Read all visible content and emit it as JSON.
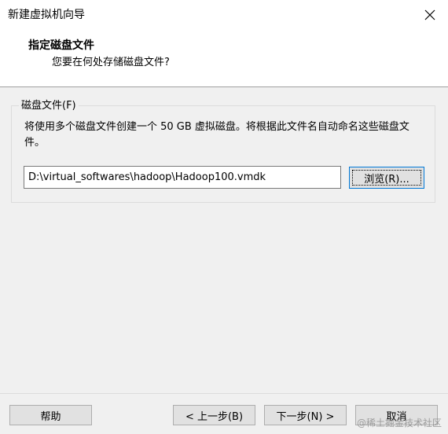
{
  "window": {
    "title": "新建虚拟机向导",
    "close_icon": "close-icon"
  },
  "header": {
    "title": "指定磁盘文件",
    "subtitle": "您要在何处存储磁盘文件?"
  },
  "disk_group": {
    "label": "磁盘文件(F)",
    "description": "将使用多个磁盘文件创建一个 50 GB 虚拟磁盘。将根据此文件名自动命名这些磁盘文件。",
    "path_value": "D:\\virtual_softwares\\hadoop\\Hadoop100.vmdk",
    "browse_label": "浏览(R)..."
  },
  "footer": {
    "help_label": "帮助",
    "back_label": "< 上一步(B)",
    "next_label": "下一步(N) >",
    "cancel_label": "取消"
  },
  "watermark": "@稀土掘金技术社区",
  "colors": {
    "background": "#f0f0f0",
    "header_background": "#ffffff",
    "button_face": "#e1e1e1",
    "button_border": "#adadad",
    "focus_border": "#0078d7"
  }
}
